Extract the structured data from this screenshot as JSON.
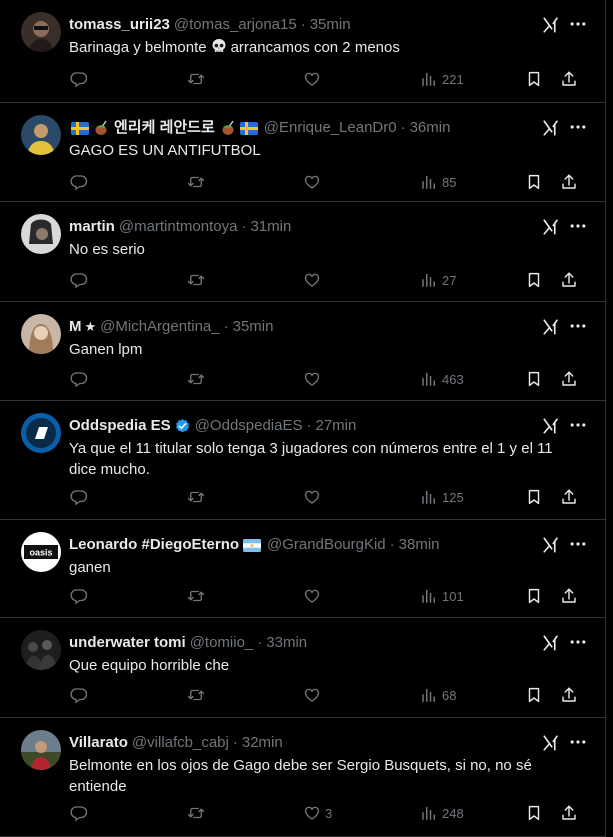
{
  "tweets": [
    {
      "name": "tomass_urii23",
      "handle": "@tomas_arjona15",
      "time": "35min",
      "text_before": "Barinaga y belmonte",
      "text_after": "arrancamos con 2 menos",
      "replies": "",
      "retweets": "",
      "likes": "",
      "views": "221"
    },
    {
      "name": "엔리케 레안드로",
      "handle": "@Enrique_LeanDr0",
      "time": "36min",
      "text": "GAGO ES UN ANTIFUTBOL",
      "replies": "",
      "retweets": "",
      "likes": "",
      "views": "85"
    },
    {
      "name": "martin",
      "handle": "@martintmontoya",
      "time": "31min",
      "text": "No es serio",
      "replies": "",
      "retweets": "",
      "likes": "",
      "views": "27"
    },
    {
      "name": "M",
      "handle": "@MichArgentina_",
      "time": "35min",
      "text": "Ganen lpm",
      "replies": "",
      "retweets": "",
      "likes": "",
      "views": "463"
    },
    {
      "name": "Oddspedia ES",
      "handle": "@OddspediaES",
      "time": "27min",
      "text": "Ya que el 11 titular solo tenga 3 jugadores con números entre el 1 y el 11 dice mucho.",
      "replies": "",
      "retweets": "",
      "likes": "",
      "views": "125"
    },
    {
      "name": "Leonardo #DiegoEterno",
      "handle": "@GrandBourgKid",
      "time": "38min",
      "text": "ganen",
      "replies": "",
      "retweets": "",
      "likes": "",
      "views": "101"
    },
    {
      "name": "underwater tomi",
      "handle": "@tomiio_",
      "time": "33min",
      "text": "Que equipo horrible che",
      "replies": "",
      "retweets": "",
      "likes": "",
      "views": "68"
    },
    {
      "name": "Villarato",
      "handle": "@villafcb_cabj",
      "time": "32min",
      "text": "Belmonte en los ojos de Gago debe ser Sergio Busquets, si no, no sé entiende",
      "replies": "",
      "retweets": "",
      "likes": "3",
      "views": "248"
    }
  ],
  "misc": {
    "dot": "·",
    "avatar_logo_text": "oasis",
    "colors": {
      "background": "#000000",
      "text": "#e7e9ea",
      "secondary": "#71767b",
      "border": "#2f3336",
      "verified": "#1d9bf0"
    },
    "icons": [
      "reply-icon",
      "retweet-icon",
      "like-icon",
      "views-icon",
      "bookmark-icon",
      "share-icon",
      "grok-icon",
      "more-icon",
      "verified-badge-icon",
      "skull-emoji",
      "sweden-flag-emoji",
      "mate-emoji",
      "argentina-flag-emoji"
    ]
  }
}
